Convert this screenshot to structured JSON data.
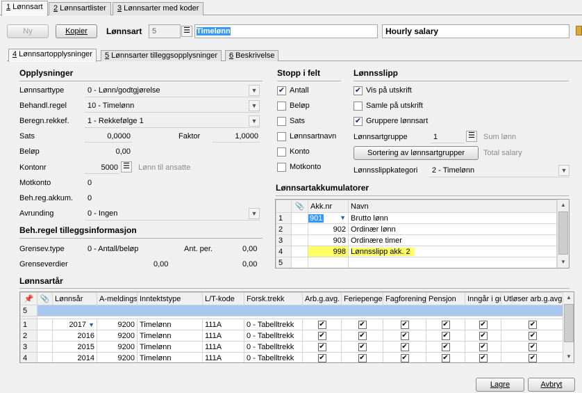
{
  "top_tabs": [
    {
      "num": "1",
      "label": " Lønnsart"
    },
    {
      "num": "2",
      "label": " Lønnsartlister"
    },
    {
      "num": "3",
      "label": " Lønnsarter med koder"
    }
  ],
  "toolbar": {
    "new_label": "Ny",
    "copy_label": "Kopier",
    "lonnsart_label": "Lønnsart",
    "lonnsart_number": "5",
    "lonnsart_name": "Timelønn",
    "english_name": "Hourly salary"
  },
  "sub_tabs": [
    {
      "num": "4",
      "label": " Lønnsartopplysninger"
    },
    {
      "num": "5",
      "label": " Lønnsarter tilleggsopplysninger"
    },
    {
      "num": "6",
      "label": " Beskrivelse"
    }
  ],
  "opplysninger": {
    "title": "Opplysninger",
    "lonnsarttype_label": "Lønnsarttype",
    "lonnsarttype_value": "0 - Lønn/godtgjørelse",
    "behandl_label": "Behandl.regel",
    "behandl_value": "10 - Timelønn",
    "beregn_label": "Beregn.rekkef.",
    "beregn_value": "1 - Rekkefølge 1",
    "sats_label": "Sats",
    "sats_value": "0,0000",
    "faktor_label": "Faktor",
    "faktor_value": "1,0000",
    "belop_label": "Beløp",
    "belop_value": "0,00",
    "kontonr_label": "Kontonr",
    "kontonr_value": "5000",
    "kontonr_desc": "Lønn til ansatte",
    "motkonto_label": "Motkonto",
    "motkonto_value": "0",
    "behreg_label": "Beh.reg.akkum.",
    "behreg_value": "0",
    "avrunding_label": "Avrunding",
    "avrunding_value": "0 - Ingen"
  },
  "behregel": {
    "title": "Beh.regel tilleggsinformasjon",
    "grensevtype_label": "Grensev.type",
    "grensevtype_value": "0 - Antall/beløp",
    "antper_label": "Ant. per.",
    "antper_value": "0,00",
    "grenseverdier_label": "Grenseverdier",
    "grenseverdier_value1": "0,00",
    "grenseverdier_value2": "0,00"
  },
  "stopp": {
    "title": "Stopp i felt",
    "items": [
      {
        "label": "Antall",
        "checked": "✔"
      },
      {
        "label": "Beløp",
        "checked": ""
      },
      {
        "label": "Sats",
        "checked": ""
      },
      {
        "label": "Lønnsartnavn",
        "checked": ""
      },
      {
        "label": "Konto",
        "checked": ""
      },
      {
        "label": "Motkonto",
        "checked": ""
      }
    ]
  },
  "lonnsslipp": {
    "title": "Lønnsslipp",
    "items": [
      {
        "label": "Vis på utskrift",
        "checked": "✔"
      },
      {
        "label": "Samle på utskrift",
        "checked": ""
      },
      {
        "label": "Gruppere lønnsart",
        "checked": "✔"
      }
    ],
    "gruppe_label": "Lønnsartgruppe",
    "gruppe_value": "1",
    "gruppe_desc": "Sum lønn",
    "sort_button": "Sortering av lønnsartgrupper",
    "sort_desc": "Total salary",
    "kategori_label": "Lønnsslippkategori",
    "kategori_value": "2 - Timelønn"
  },
  "akkumulatorer": {
    "title": "Lønnsartakkumulatorer",
    "headers": [
      "",
      "",
      "Akk.nr",
      "Navn"
    ],
    "rows": [
      {
        "rn": "1",
        "nr": "901",
        "navn": "Brutto lønn"
      },
      {
        "rn": "2",
        "nr": "902",
        "navn": "Ordinær lønn"
      },
      {
        "rn": "3",
        "nr": "903",
        "navn": "Ordinære timer"
      },
      {
        "rn": "4",
        "nr": "998",
        "navn": "Lønnsslipp akk. 2"
      },
      {
        "rn": "5",
        "nr": "",
        "navn": ""
      }
    ]
  },
  "lonnsartar": {
    "title": "Lønnsartår",
    "headers": [
      "",
      "",
      "Lønnsår",
      "A-meldings",
      "Inntektstype",
      "L/T-kode",
      "Forsk.trekk",
      "Arb.g.avg.",
      "Feriepenger",
      "Fagforening",
      "Pensjon",
      "Inngår i gr",
      "Utløser arb.g.avg"
    ],
    "new_row_num": "5",
    "rows": [
      {
        "rn": "1",
        "year": "2017",
        "amelding": "9200",
        "inntekt": "Timelønn",
        "lt": "111A",
        "forsk": "0 - Tabelltrekk",
        "checks": [
          "✔",
          "✔",
          "✔",
          "✔",
          "✔",
          "✔"
        ]
      },
      {
        "rn": "2",
        "year": "2016",
        "amelding": "9200",
        "inntekt": "Timelønn",
        "lt": "111A",
        "forsk": "0 - Tabelltrekk",
        "checks": [
          "✔",
          "✔",
          "✔",
          "✔",
          "✔",
          "✔"
        ]
      },
      {
        "rn": "3",
        "year": "2015",
        "amelding": "9200",
        "inntekt": "Timelønn",
        "lt": "111A",
        "forsk": "0 - Tabelltrekk",
        "checks": [
          "✔",
          "✔",
          "✔",
          "✔",
          "✔",
          "✔"
        ]
      },
      {
        "rn": "4",
        "year": "2014",
        "amelding": "9200",
        "inntekt": "Timelønn",
        "lt": "111A",
        "forsk": "0 - Tabelltrekk",
        "checks": [
          "✔",
          "✔",
          "✔",
          "✔",
          "✔",
          "✔"
        ]
      }
    ]
  },
  "footer": {
    "save_label": "Lagre",
    "cancel_label": "Avbryt"
  },
  "colors": {
    "selection": "#3399ff",
    "highlight": "#ffff66",
    "new_row": "#a8c8f0"
  },
  "icons": {
    "lookup": "list-icon",
    "dropdown": "chevron-down-icon",
    "pin": "pin-icon",
    "paperclip": "paperclip-icon",
    "folder": "folder-icon"
  }
}
